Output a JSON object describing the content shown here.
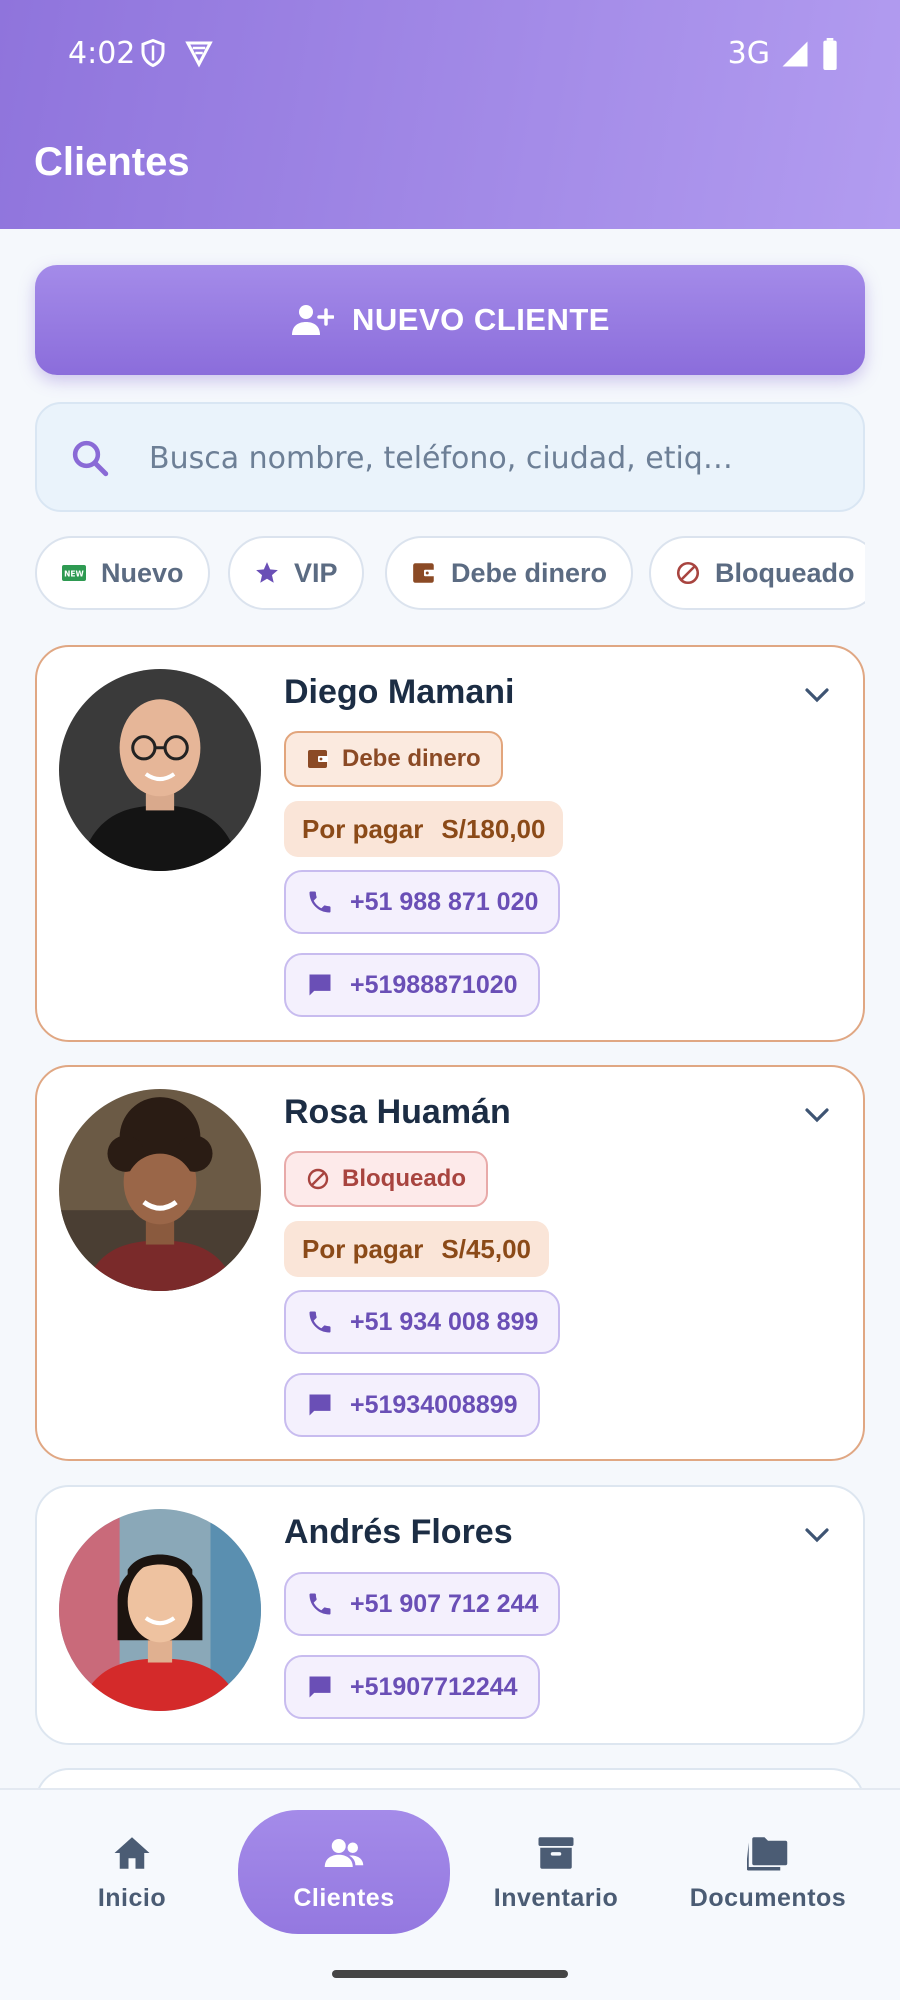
{
  "status_bar": {
    "time": "4:02",
    "network": "3G"
  },
  "header": {
    "title": "Clientes"
  },
  "actions": {
    "new_client_label": "NUEVO CLIENTE"
  },
  "search": {
    "placeholder": "Busca nombre, teléfono, ciudad, etiq…"
  },
  "filters": [
    {
      "label": "Nuevo",
      "icon": "new-badge-icon"
    },
    {
      "label": "VIP",
      "icon": "star-icon"
    },
    {
      "label": "Debe dinero",
      "icon": "wallet-icon"
    },
    {
      "label": "Bloqueado",
      "icon": "blocked-icon"
    }
  ],
  "clients": [
    {
      "name": "Diego Mamani",
      "tag": "Debe dinero",
      "tag_icon": "wallet-icon",
      "due_label": "Por pagar",
      "due_amount": "S/180,00",
      "phone": "+51 988 871 020",
      "message": "+51988871020"
    },
    {
      "name": "Rosa Huamán",
      "tag": "Bloqueado",
      "tag_icon": "blocked-icon",
      "due_label": "Por pagar",
      "due_amount": "S/45,00",
      "phone": "+51 934 008 899",
      "message": "+51934008899"
    },
    {
      "name": "Andrés Flores",
      "phone": "+51 907 712 244",
      "message": "+51907712244"
    }
  ],
  "nav": [
    {
      "label": "Inicio",
      "icon": "home-icon"
    },
    {
      "label": "Clientes",
      "icon": "people-icon",
      "active": true
    },
    {
      "label": "Inventario",
      "icon": "archive-icon"
    },
    {
      "label": "Documentos",
      "icon": "folders-icon"
    }
  ],
  "colors": {
    "accent": "#9478e0",
    "debt": "#8b4a25",
    "blocked": "#a8443f",
    "contact": "#6a4fb6"
  }
}
